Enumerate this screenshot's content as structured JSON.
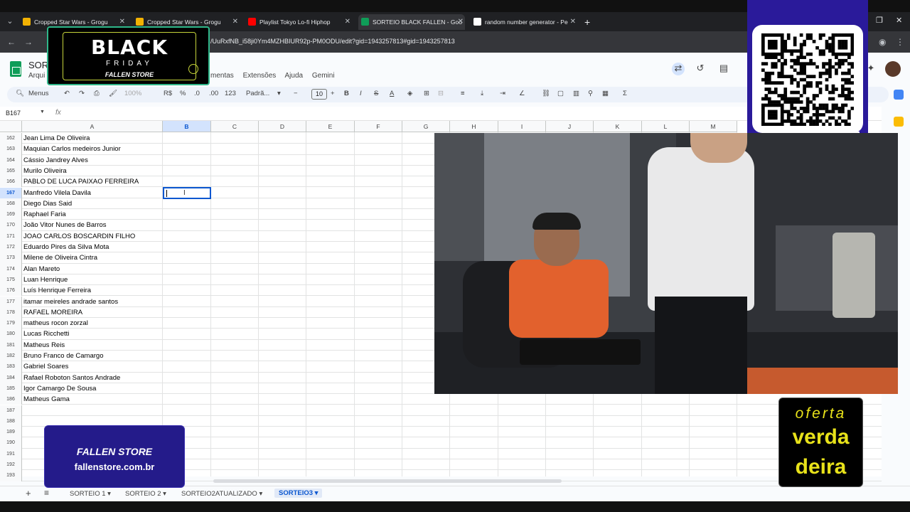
{
  "browser": {
    "tabs": [
      {
        "title": "Cropped Star Wars - Grogu",
        "fav": "#f2b203"
      },
      {
        "title": "Cropped Star Wars - Grogu",
        "fav": "#f2b203"
      },
      {
        "title": "Playlist Tokyo Lo-fi Hiphop",
        "fav": "#ff0000"
      },
      {
        "title": "SORTEIO BLACK FALLEN - Goo",
        "fav": "#0f9d58"
      },
      {
        "title": "random number generator - Pe",
        "fav": "#ffffff"
      }
    ],
    "url": "/UuRxfNB_i58ji0Ym4MZHBIUR92p-PM0ODU/edit?gid=1943257813#gid=1943257813"
  },
  "sheets": {
    "title": "SOR",
    "menu_first": "Arqui",
    "menus": [
      "mentas",
      "Extensões",
      "Ajuda",
      "Gemini"
    ]
  },
  "toolbar": {
    "menus_label": "Menus",
    "zoom": "100%",
    "currency": "R$",
    "percent": "%",
    "dec_less": ".0",
    "dec_more": ".00",
    "number_fmt": "123",
    "font": "Padrã...",
    "font_size": "10",
    "bold": "B",
    "italic": "I"
  },
  "formula_bar": {
    "cell_ref": "B167",
    "fx": "fx"
  },
  "columns": [
    "A",
    "B",
    "C",
    "D",
    "E",
    "F",
    "G",
    "H",
    "I",
    "J",
    "K",
    "L",
    "M"
  ],
  "selected_column": "B",
  "selected_row": "167",
  "rows": [
    {
      "n": "162",
      "a": "Jean Lima De Oliveira"
    },
    {
      "n": "163",
      "a": "Maquian Carlos medeiros Junior"
    },
    {
      "n": "164",
      "a": "Cássio Jandrey Alves"
    },
    {
      "n": "165",
      "a": "Murilo Oliveira"
    },
    {
      "n": "166",
      "a": "PABLO DE LUCA PAIXAO FERREIRA"
    },
    {
      "n": "167",
      "a": "Manfredo Vilela Davila"
    },
    {
      "n": "168",
      "a": "Diego Dias Said"
    },
    {
      "n": "169",
      "a": "Raphael Faria"
    },
    {
      "n": "170",
      "a": "João Vitor Nunes de Barros"
    },
    {
      "n": "171",
      "a": "JOAO CARLOS BOSCARDIN FILHO"
    },
    {
      "n": "172",
      "a": "Eduardo Pires da Silva Mota"
    },
    {
      "n": "173",
      "a": "Milene de Oliveira Cintra"
    },
    {
      "n": "174",
      "a": "Alan Mareto"
    },
    {
      "n": "175",
      "a": "Luan Henrique"
    },
    {
      "n": "176",
      "a": "Luís Henrique Ferreira"
    },
    {
      "n": "177",
      "a": "itamar meireles andrade santos"
    },
    {
      "n": "178",
      "a": "RAFAEL MOREIRA"
    },
    {
      "n": "179",
      "a": "matheus rocon zorzal"
    },
    {
      "n": "180",
      "a": "Lucas Ricchetti"
    },
    {
      "n": "181",
      "a": "Matheus Reis"
    },
    {
      "n": "182",
      "a": "Bruno Franco de Camargo"
    },
    {
      "n": "183",
      "a": "Gabriel Soares"
    },
    {
      "n": "184",
      "a": "Rafael Roboton Santos Andrade"
    },
    {
      "n": "185",
      "a": "Igor Camargo De Sousa"
    },
    {
      "n": "186",
      "a": "Matheus Gama"
    },
    {
      "n": "187",
      "a": ""
    },
    {
      "n": "188",
      "a": ""
    },
    {
      "n": "189",
      "a": ""
    },
    {
      "n": "190",
      "a": ""
    },
    {
      "n": "191",
      "a": ""
    },
    {
      "n": "192",
      "a": ""
    },
    {
      "n": "193",
      "a": ""
    }
  ],
  "sheet_tabs": [
    "SORTEIO 1",
    "SORTEIO 2",
    "SORTEIO2ATUALIZADO",
    "SORTEIO3"
  ],
  "active_sheet": "SORTEIO3",
  "overlays": {
    "bf_black": "BLACK",
    "bf_friday": "FRIDAY",
    "bf_store": "FALLEN STORE",
    "fallen_title": "FALLEN STORE",
    "fallen_url": "fallenstore.com.br",
    "oferta_top": "oferta",
    "oferta_mid": "verda",
    "oferta_bot": "deira"
  },
  "colors": {
    "accent": "#0b57d0",
    "sheets_green": "#0f9d58",
    "promo_blue": "#241b8a",
    "promo_yellow": "#e8e21a"
  }
}
